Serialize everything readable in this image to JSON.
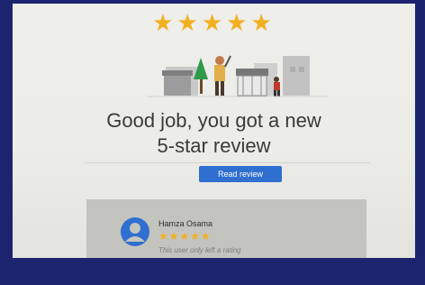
{
  "header": {
    "stars": "★★★★★",
    "title_line1": "Good job, you got a new",
    "title_line2": "5-star review"
  },
  "actions": {
    "read_review_label": "Read review"
  },
  "review": {
    "reviewer_name": "Hamza Osama",
    "rating": 5,
    "stars": "★★★★★",
    "text": "This user only left a rating"
  },
  "colors": {
    "star": "#f2b01e",
    "button": "#2f6fd0",
    "card": "#c4c4bf",
    "avatar": "#2f6fd0"
  }
}
